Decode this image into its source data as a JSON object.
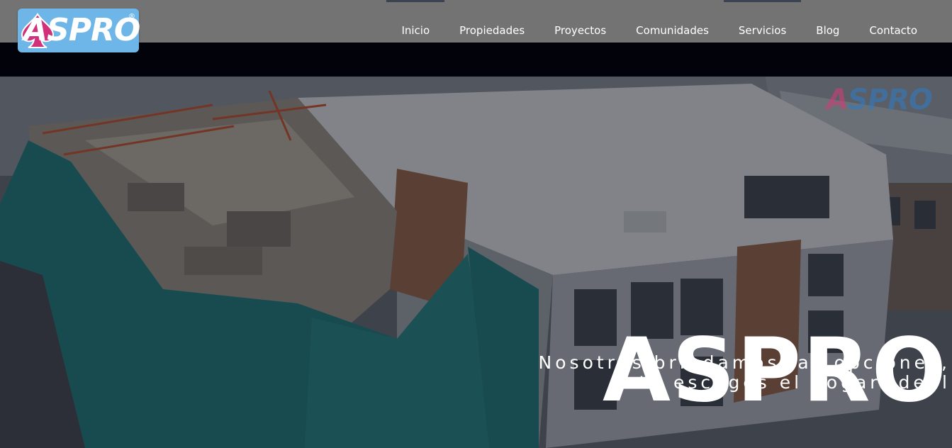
{
  "brand": {
    "logo_text": "ASPRO",
    "logo_a": "A",
    "logo_rest": "SPRO",
    "registered_mark": "®",
    "colors": {
      "logo_bg": "#6fb6e8",
      "logo_accent": "#d0317a",
      "logo_text": "#ffffff"
    }
  },
  "header": {
    "bg_color": "#737373",
    "nav": [
      {
        "label": "Inicio",
        "marked": true
      },
      {
        "label": "Propiedades",
        "marked": false
      },
      {
        "label": "Proyectos",
        "marked": false
      },
      {
        "label": "Comunidades",
        "marked": false
      },
      {
        "label": "Servicios",
        "marked": true
      },
      {
        "label": "Blog",
        "marked": false
      },
      {
        "label": "Contacto",
        "marked": false
      }
    ]
  },
  "hero": {
    "title": "ASPRO",
    "subtitle_line1": "Nosotros brindamos las opciones,",
    "subtitle_line2": "tú escoges el hogar ideal",
    "watermark_a": "A",
    "watermark_rest": "SPRO",
    "background": "aerial photo of building under construction with teal safety netting"
  }
}
